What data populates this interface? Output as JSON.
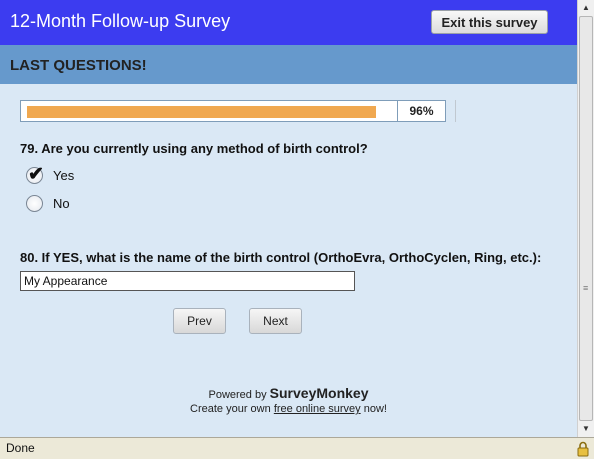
{
  "header": {
    "title": "12-Month Follow-up Survey",
    "exit_label": "Exit this survey"
  },
  "section": {
    "title": "LAST QUESTIONS!"
  },
  "progress": {
    "percent": 96,
    "label": "96%"
  },
  "questions": [
    {
      "text": "79. Are you currently using any method of birth control?",
      "options": [
        {
          "label": "Yes",
          "selected": true
        },
        {
          "label": "No",
          "selected": false
        }
      ]
    },
    {
      "text": "80. If YES, what is the name of the birth control (OrthoEvra, OrthoCyclen, Ring, etc.):",
      "answer": "My Appearance"
    }
  ],
  "nav": {
    "prev_label": "Prev",
    "next_label": "Next"
  },
  "footer": {
    "powered_prefix": "Powered by",
    "brand": "SurveyMonkey",
    "create_prefix": "Create your own",
    "create_link": "free online survey",
    "create_suffix": "now!"
  },
  "statusbar": {
    "status": "Done"
  },
  "colors": {
    "header_bg": "#3c3cf0",
    "section_bg": "#6699cc",
    "progress_fill": "#f0a850",
    "content_bg": "#dae8f5"
  }
}
